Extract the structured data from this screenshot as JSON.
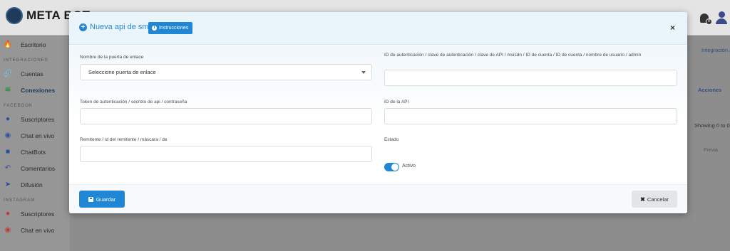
{
  "app": {
    "logo_text": "META BOT",
    "notification_count": "0"
  },
  "sidebar": {
    "items": [
      {
        "label": "Escritorio",
        "icon": "fire-icon",
        "color": "#c0392b"
      },
      {
        "section": "INTEGRACIONES"
      },
      {
        "label": "Cuentas",
        "icon": "link-icon",
        "color": "#2f8f3f"
      },
      {
        "label": "Conexiones",
        "icon": "wifi-icon",
        "color": "#2f8f3f",
        "active": true
      },
      {
        "section": "FACEBOOK"
      },
      {
        "label": "Suscriptores",
        "icon": "user-circle-icon",
        "color": "#2a4fa0"
      },
      {
        "label": "Chat en vivo",
        "icon": "headset-icon",
        "color": "#2a4fa0"
      },
      {
        "label": "ChatBots",
        "icon": "robot-icon",
        "color": "#2a4fa0"
      },
      {
        "label": "Comentarios",
        "icon": "reply-icon",
        "color": "#2a4fa0"
      },
      {
        "label": "Difusión",
        "icon": "send-icon",
        "color": "#2a4fa0"
      },
      {
        "section": "INSTAGRAM"
      },
      {
        "label": "Suscriptores",
        "icon": "user-circle-icon",
        "color": "#c0392b"
      },
      {
        "label": "Chat en vivo",
        "icon": "headset-icon",
        "color": "#c0392b"
      }
    ]
  },
  "background": {
    "breadcrumb": "Integración",
    "breadcrumb_sep": "/",
    "col_actions": "Acciones",
    "showing": "Showing 0 to 0",
    "prev": "Previa"
  },
  "modal": {
    "title": "Nueva api de sms",
    "instructions_label": "Instrucciones",
    "close": "×",
    "fields": {
      "gateway_label": "Nombre de la puerta de enlace",
      "gateway_value": "Seleccione puerta de enlace",
      "auth_id_label": "ID de autenticación / clave de autenticación / clave de API / msisdn / ID de cuenta / ID de cuenta / nombre de usuario / admin",
      "auth_id_value": "",
      "token_label": "Token de autenticación / secreto de api / contraseña",
      "token_value": "",
      "api_id_label": "ID de la API",
      "api_id_value": "",
      "sender_label": "Remitente / id del remitente / máscara / de",
      "sender_value": "",
      "status_label": "Estado",
      "status_value": "Activo",
      "status_on": true
    },
    "save_label": "Guardar",
    "cancel_label": "Cancelar",
    "accent_color": "#1f87d6"
  }
}
